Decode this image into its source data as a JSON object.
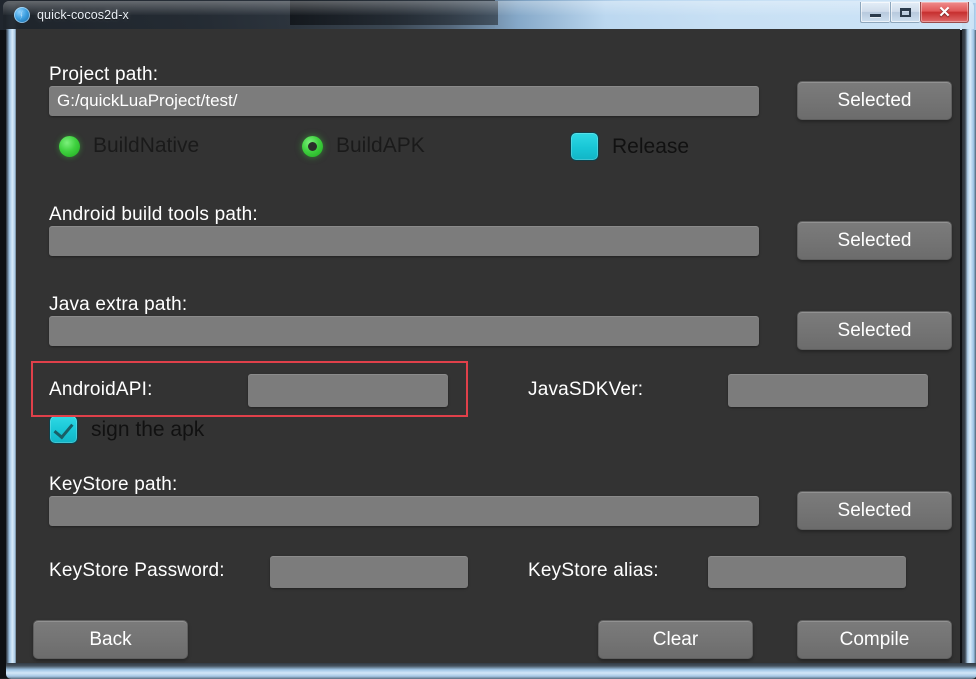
{
  "window": {
    "title": "quick-cocos2d-x",
    "app_icon": "lightning-globe-icon",
    "controls": {
      "minimize_label": "—",
      "maximize_label": "□",
      "close_label": "✕"
    }
  },
  "colors": {
    "content_bg": "#333333",
    "input_bg": "#7c7c7c",
    "button_bg": "#747474",
    "radio_green": "#3fd13f",
    "checkbox_cyan": "#18c6d6",
    "annotation_red": "#e0404a",
    "title_text": "#e8eef4"
  },
  "form": {
    "project_path": {
      "label": "Project path:",
      "value": "G:/quickLuaProject/test/",
      "placeholder": "",
      "button_label": "Selected"
    },
    "build_options": {
      "native": {
        "label": "BuildNative",
        "selected": false,
        "style": "filled-dot"
      },
      "apk": {
        "label": "BuildAPK",
        "selected": true,
        "style": "ring-dot"
      },
      "release": {
        "label": "Release",
        "checked": false
      }
    },
    "android_build_tools_path": {
      "label": "Android build tools path:",
      "value": "",
      "placeholder": "",
      "button_label": "Selected"
    },
    "java_extra_path": {
      "label": "Java extra path:",
      "value": "",
      "placeholder": "",
      "button_label": "Selected"
    },
    "android_api": {
      "label": "AndroidAPI:",
      "value": "",
      "placeholder": ""
    },
    "java_sdk_ver": {
      "label": "JavaSDKVer:",
      "value": "",
      "placeholder": ""
    },
    "sign_the_apk": {
      "label": "sign the apk",
      "checked": true
    },
    "keystore_path": {
      "label": "KeyStore path:",
      "value": "",
      "placeholder": "",
      "button_label": "Selected"
    },
    "keystore_password": {
      "label": "KeyStore Password:",
      "value": "",
      "placeholder": ""
    },
    "keystore_alias": {
      "label": "KeyStore alias:",
      "value": "",
      "placeholder": ""
    }
  },
  "footer": {
    "back_label": "Back",
    "clear_label": "Clear",
    "compile_label": "Compile"
  },
  "annotation": {
    "name": "android-api-highlight",
    "color": "#e0404a"
  }
}
